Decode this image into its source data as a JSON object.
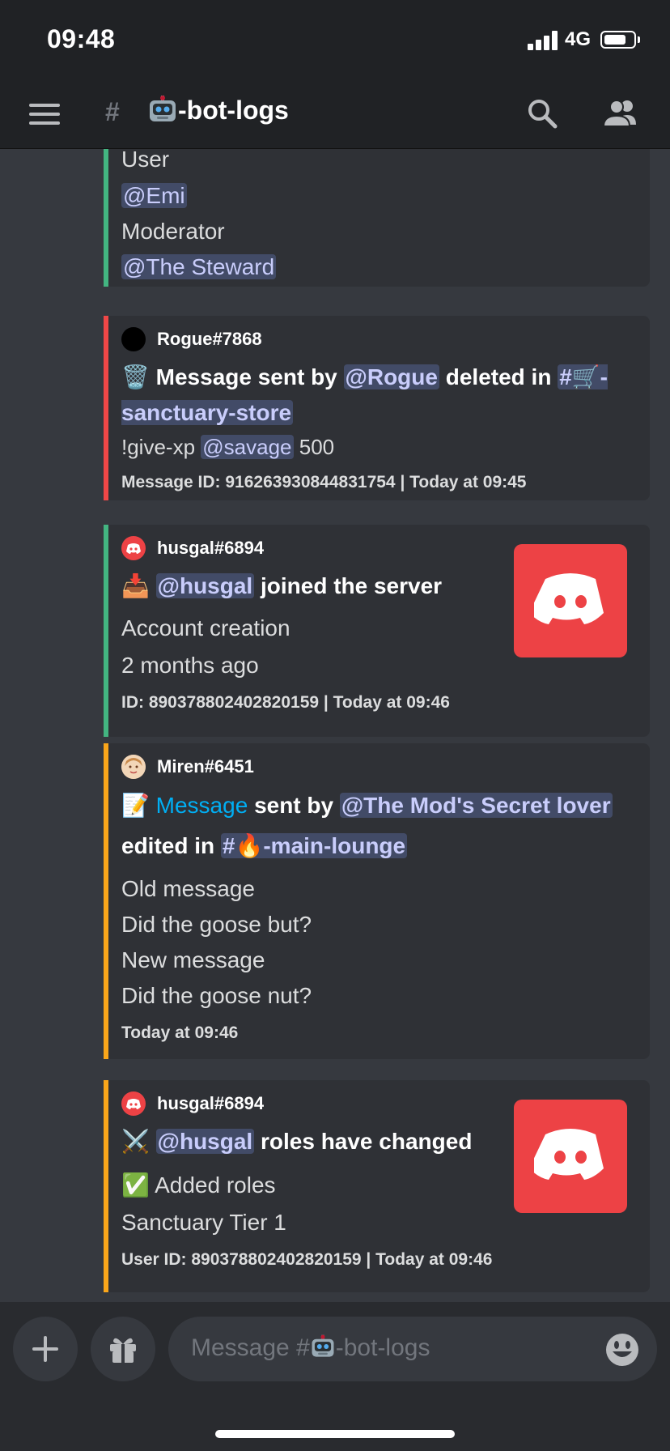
{
  "status_bar": {
    "time": "09:48",
    "network": "4G"
  },
  "header": {
    "channel_name": "-bot-logs"
  },
  "embeds": [
    {
      "color": "#43b581",
      "lines": [
        "User",
        "@Emi",
        "Moderator",
        "@The Steward"
      ]
    },
    {
      "color": "#f04747",
      "author": "Rogue#7868",
      "title_parts": [
        "Message sent by",
        "@Rogue",
        "deleted in",
        "#🛒-sanctuary-store"
      ],
      "content_prefix": "!give-xp",
      "content_mention": "@savage",
      "content_suffix": "500",
      "footer": "Message ID: 916263930844831754 | Today at 09:45"
    },
    {
      "color": "#43b581",
      "author": "husgal#6894",
      "title_mention": "@husgal",
      "title_rest": "joined the server",
      "field_name": "Account creation",
      "field_value": "2 months ago",
      "footer": "ID: 890378802402820159 | Today at 09:46"
    },
    {
      "color": "#faa61a",
      "author": "Miren#6451",
      "title_link": "Message",
      "title_sent_by": "sent by",
      "title_mention": "@The Mod's Secret lover",
      "title_edited_in": "edited in",
      "title_channel": "#🔥-main-lounge",
      "old_label": "Old message",
      "old_value": "Did the goose but?",
      "new_label": "New message",
      "new_value": "Did the goose nut?",
      "footer": "Today at 09:46"
    },
    {
      "color": "#faa61a",
      "author": "husgal#6894",
      "title_mention": "@husgal",
      "title_rest": "roles have changed",
      "field_name": "✅ Added roles",
      "field_value": "Sanctuary Tier 1",
      "footer": "User ID: 890378802402820159 | Today at 09:46"
    }
  ],
  "composer": {
    "placeholder_prefix": "Message #",
    "placeholder_suffix": "-bot-logs"
  }
}
